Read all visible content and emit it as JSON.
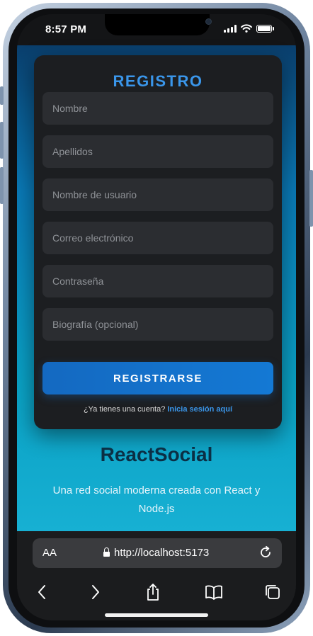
{
  "status_bar": {
    "time": "8:57 PM"
  },
  "form": {
    "title": "REGISTRO",
    "fields": [
      {
        "placeholder": "Nombre",
        "value": ""
      },
      {
        "placeholder": "Apellidos",
        "value": ""
      },
      {
        "placeholder": "Nombre de usuario",
        "value": ""
      },
      {
        "placeholder": "Correo electrónico",
        "value": ""
      },
      {
        "placeholder": "Contraseña",
        "value": ""
      },
      {
        "placeholder": "Biografía (opcional)",
        "value": ""
      }
    ],
    "submit_label": "REGISTRARSE",
    "login_prompt": "¿Ya tienes una cuenta?",
    "login_link": "Inicia sesión aquí"
  },
  "brand": {
    "name": "ReactSocial",
    "tagline": "Una red social moderna creada con React y Node.js"
  },
  "browser": {
    "text_size_label": "AA",
    "url": "http://localhost:5173",
    "nav_icons": [
      "back-icon",
      "forward-icon",
      "share-icon",
      "bookmarks-icon",
      "tabs-icon"
    ]
  },
  "colors": {
    "accent": "#3a96ea",
    "button": "#1470c9",
    "card_bg": "#1c1e21",
    "input_bg": "#2b2d31",
    "bg_top": "#0a3f6d",
    "bg_bottom": "#17b0d3"
  }
}
